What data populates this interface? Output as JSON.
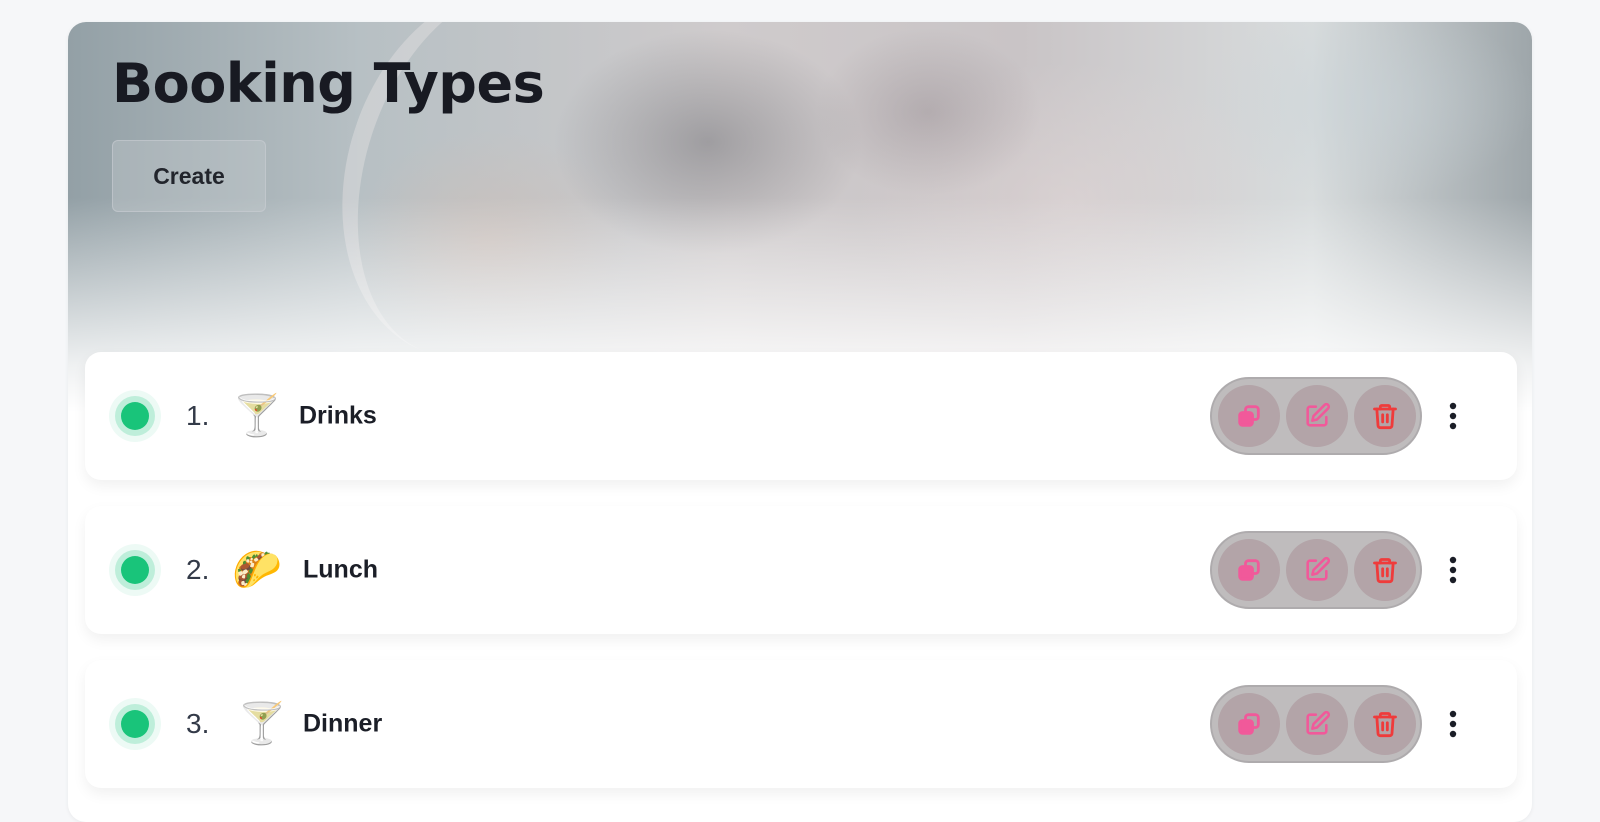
{
  "page": {
    "title": "Booking Types",
    "create_label": "Create"
  },
  "booking_types": [
    {
      "number": "1.",
      "emoji": "🍸",
      "name": "Drinks",
      "active": true
    },
    {
      "number": "2.",
      "emoji": "🌮",
      "name": "Lunch",
      "active": true
    },
    {
      "number": "3.",
      "emoji": "🍸",
      "name": "Dinner",
      "active": true
    }
  ],
  "icons": {
    "status": "status-dot-icon",
    "duplicate": "duplicate-icon",
    "edit": "edit-icon",
    "delete": "trash-icon",
    "more": "more-vertical-icon"
  },
  "colors": {
    "status_active": "#19c47a",
    "action_pink": "#f1599a",
    "delete_red": "#ef3b3b",
    "title": "#181a22"
  }
}
